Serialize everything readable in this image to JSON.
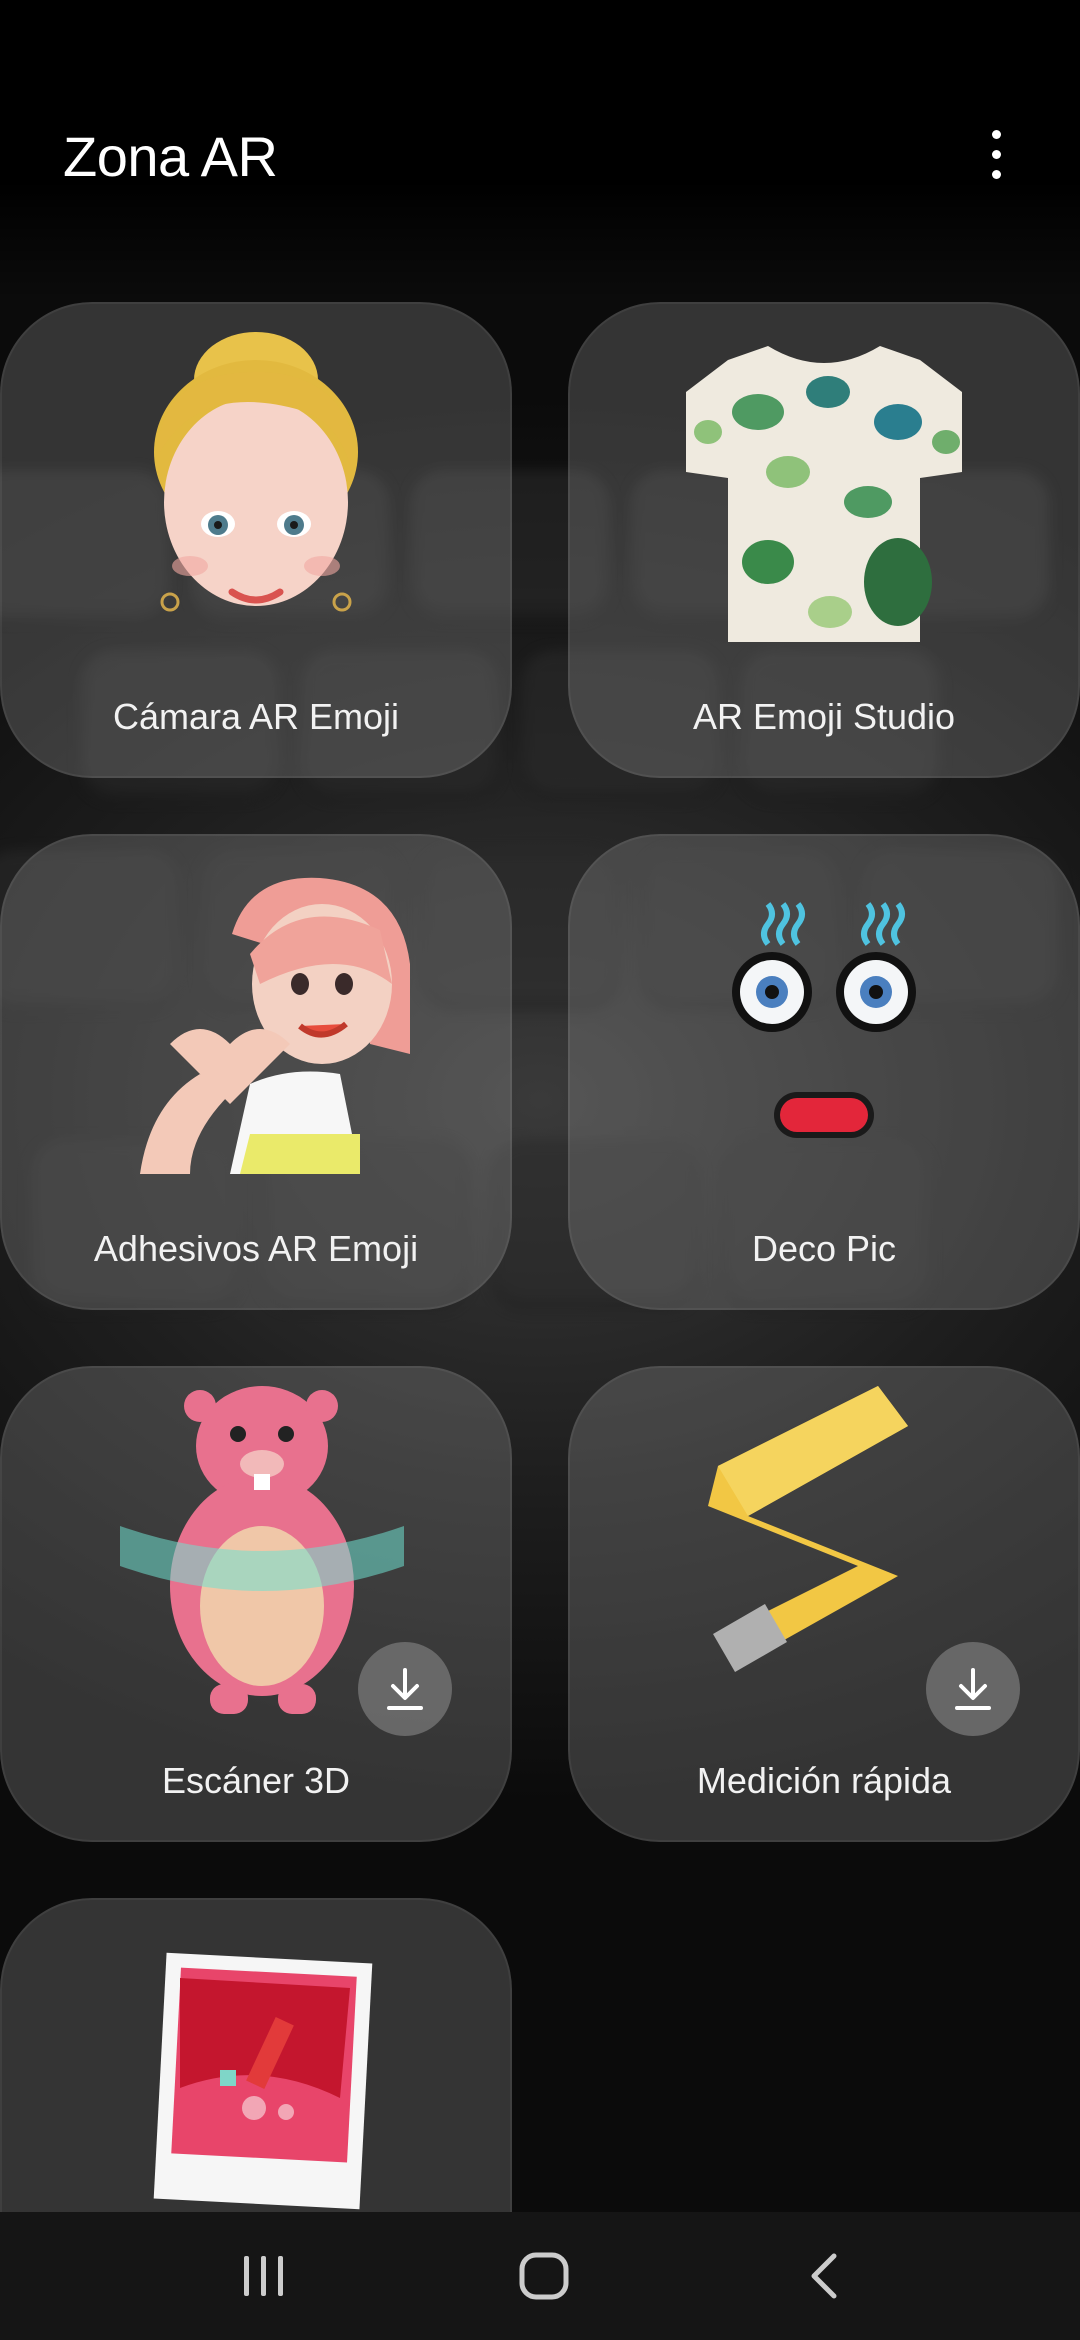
{
  "header": {
    "title": "Zona AR",
    "more_icon": "more-vertical-icon"
  },
  "tiles": [
    {
      "label": "Cámara AR Emoji",
      "icon": "ar-emoji-face-icon",
      "download": false
    },
    {
      "label": "AR Emoji Studio",
      "icon": "tshirt-icon",
      "download": false
    },
    {
      "label": "Adhesivos AR Emoji",
      "icon": "emoji-stickers-icon",
      "download": false
    },
    {
      "label": "Deco Pic",
      "icon": "deco-pic-icon",
      "download": false
    },
    {
      "label": "Escáner 3D",
      "icon": "3d-scanner-icon",
      "download": true
    },
    {
      "label": "Medición rápida",
      "icon": "measuring-tape-icon",
      "download": true
    },
    {
      "label": "",
      "icon": "ar-doodle-photo-icon",
      "download": true
    }
  ],
  "navbar": {
    "recents_icon": "recents-icon",
    "home_icon": "home-icon",
    "back_icon": "back-icon"
  },
  "colors": {
    "tile_bg": "#8c8c8c",
    "header_bg": "#000000",
    "nav_bg": "#151515"
  }
}
